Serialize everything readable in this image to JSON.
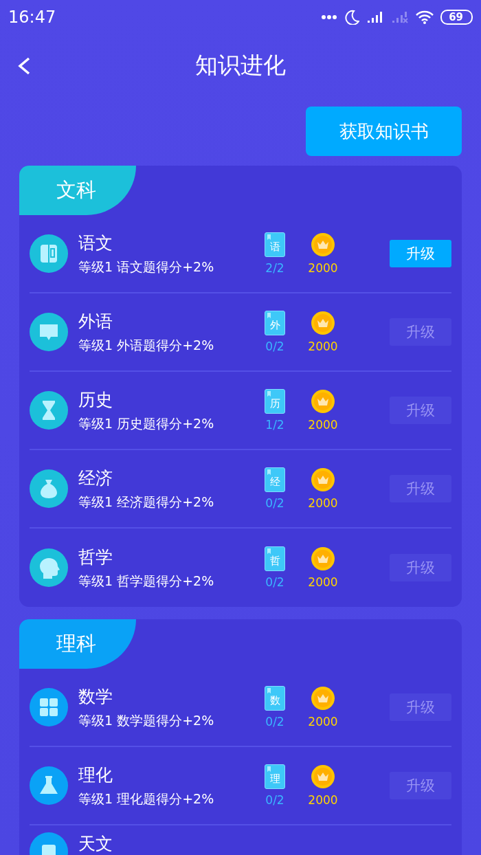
{
  "status_bar": {
    "time": "16:47",
    "battery": "69"
  },
  "header": {
    "title": "知识进化"
  },
  "action_button": {
    "label": "获取知识书"
  },
  "categories": [
    {
      "title": "文科",
      "color": "#1cc0da",
      "items": [
        {
          "name": "语文",
          "desc": "等级1 语文题得分+2%",
          "book_label": "语",
          "book_count": "2/2",
          "cost": "2000",
          "button": "升级",
          "disabled": false
        },
        {
          "name": "外语",
          "desc": "等级1 外语题得分+2%",
          "book_label": "外",
          "book_count": "0/2",
          "cost": "2000",
          "button": "升级",
          "disabled": true
        },
        {
          "name": "历史",
          "desc": "等级1 历史题得分+2%",
          "book_label": "历",
          "book_count": "1/2",
          "cost": "2000",
          "button": "升级",
          "disabled": true
        },
        {
          "name": "经济",
          "desc": "等级1 经济题得分+2%",
          "book_label": "经",
          "book_count": "0/2",
          "cost": "2000",
          "button": "升级",
          "disabled": true
        },
        {
          "name": "哲学",
          "desc": "等级1 哲学题得分+2%",
          "book_label": "哲",
          "book_count": "0/2",
          "cost": "2000",
          "button": "升级",
          "disabled": true
        }
      ]
    },
    {
      "title": "理科",
      "color": "#0aa2f6",
      "items": [
        {
          "name": "数学",
          "desc": "等级1 数学题得分+2%",
          "book_label": "数",
          "book_count": "0/2",
          "cost": "2000",
          "button": "升级",
          "disabled": true
        },
        {
          "name": "理化",
          "desc": "等级1 理化题得分+2%",
          "book_label": "理",
          "book_count": "0/2",
          "cost": "2000",
          "button": "升级",
          "disabled": true
        },
        {
          "name": "天文"
        }
      ]
    }
  ]
}
